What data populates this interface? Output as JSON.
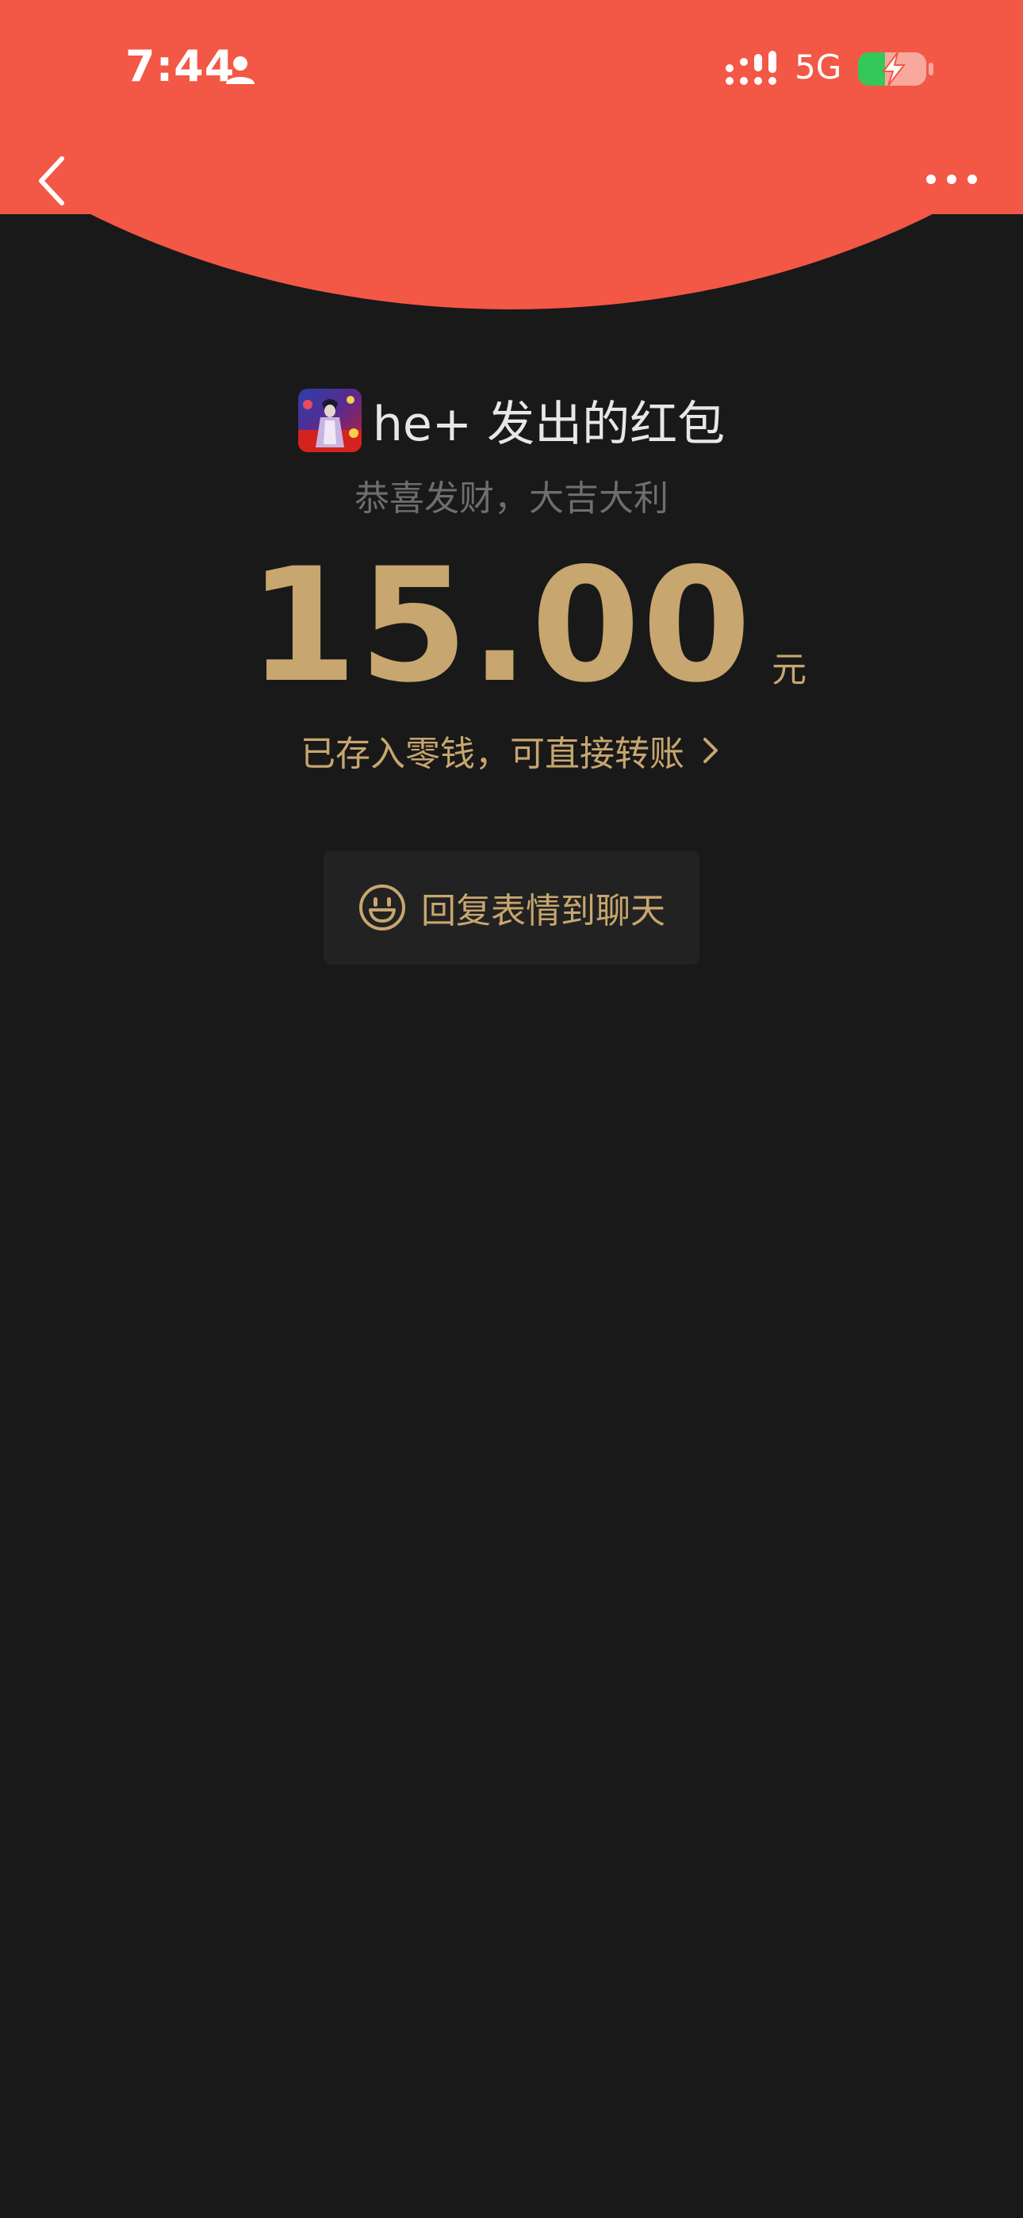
{
  "status_bar": {
    "time": "7:44",
    "network": "5G",
    "person_icon": "person-icon",
    "signal_icon": "signal-icon",
    "battery_icon": "battery-charging-icon"
  },
  "nav": {
    "back_icon": "chevron-left-icon",
    "more_icon": "more-dots-icon"
  },
  "red_packet": {
    "sender_title": "he+ 发出的红包",
    "wish": "恭喜发财，大吉大利",
    "amount": "15.00",
    "unit": "元",
    "stored_text": "已存入零钱，可直接转账",
    "reply_label": "回复表情到聊天"
  },
  "colors": {
    "header_red": "#F35746",
    "background": "#191919",
    "gold": "#C7A66F",
    "battery_green": "#34C759"
  }
}
